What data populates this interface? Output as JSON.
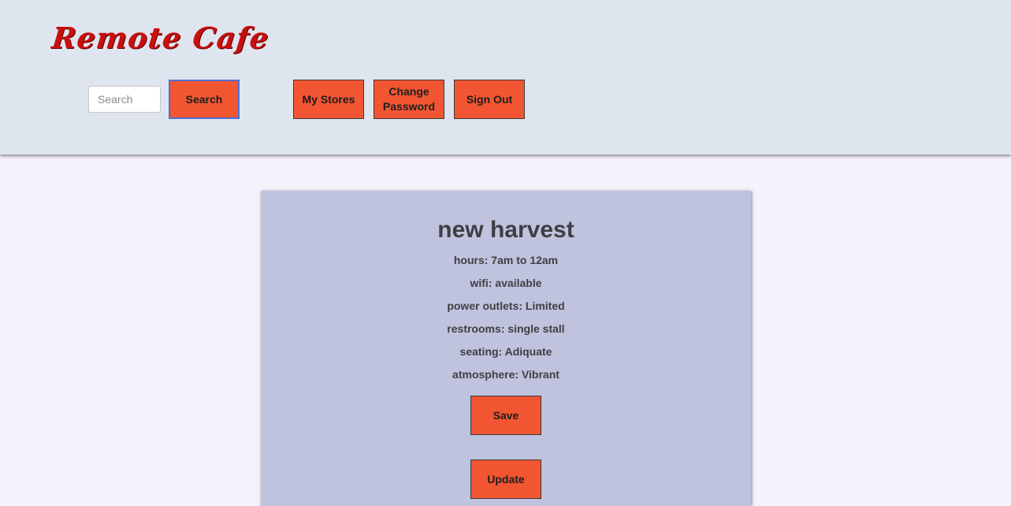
{
  "header": {
    "logo": "Remote Cafe",
    "search_placeholder": "Search",
    "search_value": "",
    "search_button": "Search",
    "nav": {
      "my_stores": "My Stores",
      "change_password": "Change Password",
      "sign_out": "Sign Out"
    }
  },
  "store": {
    "name": "new harvest",
    "details": {
      "hours": "hours: 7am to 12am",
      "wifi": "wifi: available",
      "power": "power outlets: Limited",
      "restrooms": "restrooms: single stall",
      "seating": "seating: Adiquate",
      "atmosphere": "atmosphere: Vibrant"
    },
    "save_button": "Save",
    "update_button": "Update"
  },
  "colors": {
    "header_bg": "#dfe5ef",
    "page_bg": "#f6f2fc",
    "card_bg": "#bfc3de",
    "button_bg": "#f25532",
    "logo": "#c80f0f"
  }
}
